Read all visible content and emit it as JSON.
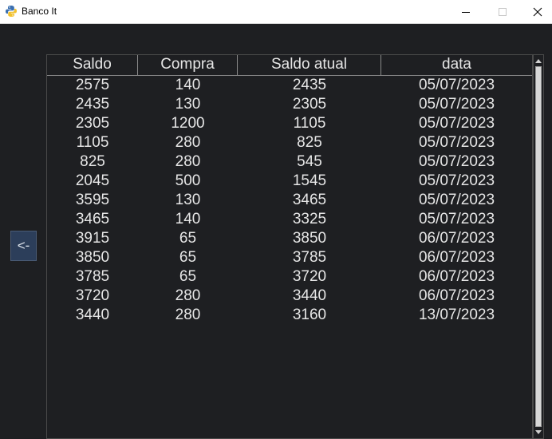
{
  "window": {
    "title": "Banco It",
    "icon": "python-icon",
    "controls": {
      "minimize": "minimize-icon",
      "maximize": "maximize-icon",
      "close": "close-icon"
    }
  },
  "back_button": {
    "label": "<-"
  },
  "table": {
    "columns": [
      "Saldo",
      "Compra",
      "Saldo atual",
      "data"
    ],
    "rows": [
      [
        "2575",
        "140",
        "2435",
        "05/07/2023"
      ],
      [
        "2435",
        "130",
        "2305",
        "05/07/2023"
      ],
      [
        "2305",
        "1200",
        "1105",
        "05/07/2023"
      ],
      [
        "1105",
        "280",
        "825",
        "05/07/2023"
      ],
      [
        "825",
        "280",
        "545",
        "05/07/2023"
      ],
      [
        "2045",
        "500",
        "1545",
        "05/07/2023"
      ],
      [
        "3595",
        "130",
        "3465",
        "05/07/2023"
      ],
      [
        "3465",
        "140",
        "3325",
        "05/07/2023"
      ],
      [
        "3915",
        "65",
        "3850",
        "06/07/2023"
      ],
      [
        "3850",
        "65",
        "3785",
        "06/07/2023"
      ],
      [
        "3785",
        "65",
        "3720",
        "06/07/2023"
      ],
      [
        "3720",
        "280",
        "3440",
        "06/07/2023"
      ],
      [
        "3440",
        "280",
        "3160",
        "13/07/2023"
      ]
    ]
  },
  "colors": {
    "background": "#1e1f22",
    "text": "#e6e6e6",
    "button": "#2c3e5a"
  }
}
